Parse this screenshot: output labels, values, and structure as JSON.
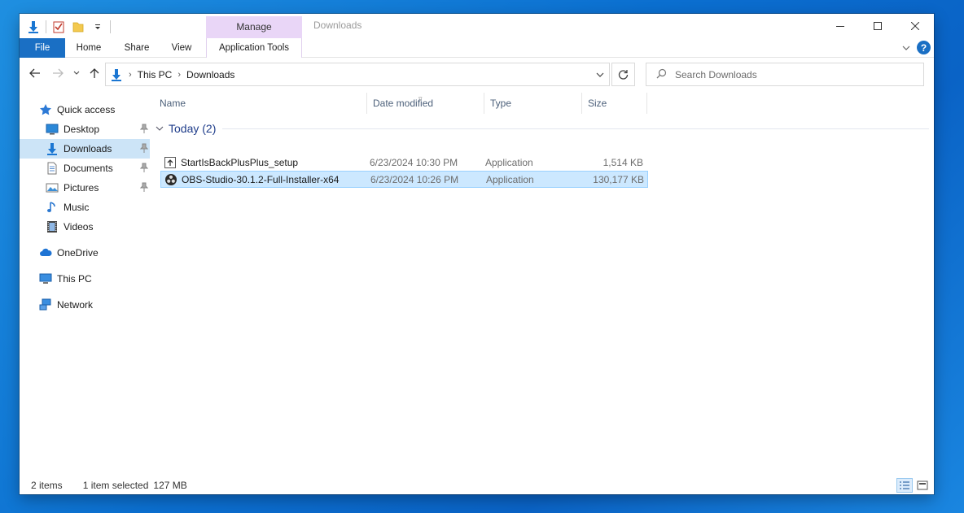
{
  "window": {
    "title": "Downloads",
    "contextual_tab": "Manage"
  },
  "ribbon": {
    "tabs": [
      "File",
      "Home",
      "Share",
      "View",
      "Application Tools"
    ]
  },
  "address": {
    "crumbs": [
      "This PC",
      "Downloads"
    ]
  },
  "search": {
    "placeholder": "Search Downloads"
  },
  "sidebar": {
    "quick_access": "Quick access",
    "items": [
      {
        "label": "Desktop",
        "icon": "desktop-icon",
        "pinned": true
      },
      {
        "label": "Downloads",
        "icon": "downloads-icon",
        "pinned": true,
        "selected": true
      },
      {
        "label": "Documents",
        "icon": "documents-icon",
        "pinned": true
      },
      {
        "label": "Pictures",
        "icon": "pictures-icon",
        "pinned": true
      },
      {
        "label": "Music",
        "icon": "music-icon",
        "pinned": false
      },
      {
        "label": "Videos",
        "icon": "videos-icon",
        "pinned": false
      }
    ],
    "onedrive": "OneDrive",
    "this_pc": "This PC",
    "network": "Network"
  },
  "columns": [
    "Name",
    "Date modified",
    "Type",
    "Size"
  ],
  "group": {
    "title": "Today (2)"
  },
  "files": [
    {
      "name": "StartIsBackPlusPlus_setup",
      "date": "6/23/2024 10:30 PM",
      "type": "Application",
      "size": "1,514 KB",
      "selected": false
    },
    {
      "name": "OBS-Studio-30.1.2-Full-Installer-x64",
      "date": "6/23/2024 10:26 PM",
      "type": "Application",
      "size": "130,177 KB",
      "selected": true
    }
  ],
  "status": {
    "items": "2 items",
    "selected": "1 item selected",
    "size": "127 MB"
  },
  "colors": {
    "accent": "#1a6fc4",
    "selection": "#cce8ff",
    "manage_tab": "#e9d6f7",
    "group_title": "#1e3c8a"
  }
}
